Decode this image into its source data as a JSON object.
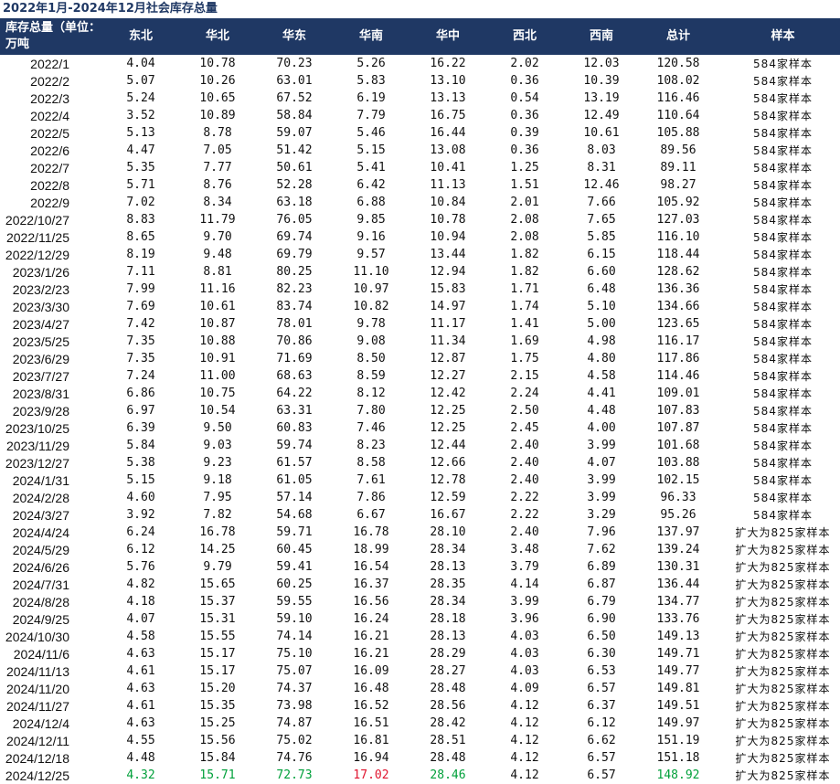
{
  "title": "2022年1月-2024年12月社会库存总量",
  "colors": {
    "header_bg": "#1f3864",
    "header_text": "#ffffff",
    "up": "#e0142e",
    "down": "#00a03a"
  },
  "headers": [
    "库存总量（单位：万吨",
    "东北",
    "华北",
    "华东",
    "华南",
    "华中",
    "西北",
    "西南",
    "总计",
    "样本"
  ],
  "rows": [
    [
      "2022/1",
      "4.04",
      "10.78",
      "70.23",
      "5.26",
      "16.22",
      "2.02",
      "12.03",
      "120.58",
      "584家样本"
    ],
    [
      "2022/2",
      "5.07",
      "10.26",
      "63.01",
      "5.83",
      "13.10",
      "0.36",
      "10.39",
      "108.02",
      "584家样本"
    ],
    [
      "2022/3",
      "5.24",
      "10.65",
      "67.52",
      "6.19",
      "13.13",
      "0.54",
      "13.19",
      "116.46",
      "584家样本"
    ],
    [
      "2022/4",
      "3.52",
      "10.89",
      "58.84",
      "7.79",
      "16.75",
      "0.36",
      "12.49",
      "110.64",
      "584家样本"
    ],
    [
      "2022/5",
      "5.13",
      "8.78",
      "59.07",
      "5.46",
      "16.44",
      "0.39",
      "10.61",
      "105.88",
      "584家样本"
    ],
    [
      "2022/6",
      "4.47",
      "7.05",
      "51.42",
      "5.15",
      "13.08",
      "0.36",
      "8.03",
      "89.56",
      "584家样本"
    ],
    [
      "2022/7",
      "5.35",
      "7.77",
      "50.61",
      "5.41",
      "10.41",
      "1.25",
      "8.31",
      "89.11",
      "584家样本"
    ],
    [
      "2022/8",
      "5.71",
      "8.76",
      "52.28",
      "6.42",
      "11.13",
      "1.51",
      "12.46",
      "98.27",
      "584家样本"
    ],
    [
      "2022/9",
      "7.02",
      "8.34",
      "63.18",
      "6.88",
      "10.84",
      "2.01",
      "7.66",
      "105.92",
      "584家样本"
    ],
    [
      "2022/10/27",
      "8.83",
      "11.79",
      "76.05",
      "9.85",
      "10.78",
      "2.08",
      "7.65",
      "127.03",
      "584家样本"
    ],
    [
      "2022/11/25",
      "8.65",
      "9.70",
      "69.74",
      "9.16",
      "10.94",
      "2.08",
      "5.85",
      "116.10",
      "584家样本"
    ],
    [
      "2022/12/29",
      "8.19",
      "9.48",
      "69.79",
      "9.57",
      "13.44",
      "1.82",
      "6.15",
      "118.44",
      "584家样本"
    ],
    [
      "2023/1/26",
      "7.11",
      "8.81",
      "80.25",
      "11.10",
      "12.94",
      "1.82",
      "6.60",
      "128.62",
      "584家样本"
    ],
    [
      "2023/2/23",
      "7.99",
      "11.16",
      "82.23",
      "10.97",
      "15.83",
      "1.71",
      "6.48",
      "136.36",
      "584家样本"
    ],
    [
      "2023/3/30",
      "7.69",
      "10.61",
      "83.74",
      "10.82",
      "14.97",
      "1.74",
      "5.10",
      "134.66",
      "584家样本"
    ],
    [
      "2023/4/27",
      "7.42",
      "10.87",
      "78.01",
      "9.78",
      "11.17",
      "1.41",
      "5.00",
      "123.65",
      "584家样本"
    ],
    [
      "2023/5/25",
      "7.35",
      "10.88",
      "70.86",
      "9.08",
      "11.34",
      "1.69",
      "4.98",
      "116.17",
      "584家样本"
    ],
    [
      "2023/6/29",
      "7.35",
      "10.91",
      "71.69",
      "8.50",
      "12.87",
      "1.75",
      "4.80",
      "117.86",
      "584家样本"
    ],
    [
      "2023/7/27",
      "7.24",
      "11.00",
      "68.63",
      "8.59",
      "12.27",
      "2.15",
      "4.58",
      "114.46",
      "584家样本"
    ],
    [
      "2023/8/31",
      "6.86",
      "10.75",
      "64.22",
      "8.12",
      "12.42",
      "2.24",
      "4.41",
      "109.01",
      "584家样本"
    ],
    [
      "2023/9/28",
      "6.97",
      "10.54",
      "63.31",
      "7.80",
      "12.25",
      "2.50",
      "4.48",
      "107.83",
      "584家样本"
    ],
    [
      "2023/10/25",
      "6.39",
      "9.50",
      "60.83",
      "7.46",
      "12.25",
      "2.45",
      "4.00",
      "107.87",
      "584家样本"
    ],
    [
      "2023/11/29",
      "5.84",
      "9.03",
      "59.74",
      "8.23",
      "12.44",
      "2.40",
      "3.99",
      "101.68",
      "584家样本"
    ],
    [
      "2023/12/27",
      "5.38",
      "9.23",
      "61.57",
      "8.58",
      "12.66",
      "2.40",
      "4.07",
      "103.88",
      "584家样本"
    ],
    [
      "2024/1/31",
      "5.15",
      "9.18",
      "61.05",
      "7.61",
      "12.78",
      "2.40",
      "3.99",
      "102.15",
      "584家样本"
    ],
    [
      "2024/2/28",
      "4.60",
      "7.95",
      "57.14",
      "7.86",
      "12.59",
      "2.22",
      "3.99",
      "96.33",
      "584家样本"
    ],
    [
      "2024/3/27",
      "3.92",
      "7.82",
      "54.68",
      "6.67",
      "16.67",
      "2.22",
      "3.29",
      "95.26",
      "584家样本"
    ],
    [
      "2024/4/24",
      "6.24",
      "16.78",
      "59.71",
      "16.78",
      "28.10",
      "2.40",
      "7.96",
      "137.97",
      "扩大为825家样本"
    ],
    [
      "2024/5/29",
      "6.12",
      "14.25",
      "60.45",
      "18.99",
      "28.34",
      "3.48",
      "7.62",
      "139.24",
      "扩大为825家样本"
    ],
    [
      "2024/6/26",
      "5.76",
      "9.79",
      "59.41",
      "16.54",
      "28.13",
      "3.79",
      "6.89",
      "130.31",
      "扩大为825家样本"
    ],
    [
      "2024/7/31",
      "4.82",
      "15.65",
      "60.25",
      "16.37",
      "28.35",
      "4.14",
      "6.87",
      "136.44",
      "扩大为825家样本"
    ],
    [
      "2024/8/28",
      "4.18",
      "15.37",
      "59.55",
      "16.56",
      "28.34",
      "3.99",
      "6.79",
      "134.77",
      "扩大为825家样本"
    ],
    [
      "2024/9/25",
      "4.07",
      "15.31",
      "59.10",
      "16.24",
      "28.18",
      "3.96",
      "6.90",
      "133.76",
      "扩大为825家样本"
    ],
    [
      "2024/10/30",
      "4.58",
      "15.55",
      "74.14",
      "16.21",
      "28.13",
      "4.03",
      "6.50",
      "149.13",
      "扩大为825家样本"
    ],
    [
      "2024/11/6",
      "4.63",
      "15.17",
      "75.10",
      "16.21",
      "28.29",
      "4.03",
      "6.30",
      "149.71",
      "扩大为825家样本"
    ],
    [
      "2024/11/13",
      "4.61",
      "15.17",
      "75.07",
      "16.09",
      "28.27",
      "4.03",
      "6.53",
      "149.77",
      "扩大为825家样本"
    ],
    [
      "2024/11/20",
      "4.63",
      "15.20",
      "74.37",
      "16.48",
      "28.48",
      "4.09",
      "6.57",
      "149.81",
      "扩大为825家样本"
    ],
    [
      "2024/11/27",
      "4.61",
      "15.35",
      "73.98",
      "16.52",
      "28.56",
      "4.12",
      "6.37",
      "149.51",
      "扩大为825家样本"
    ],
    [
      "2024/12/4",
      "4.63",
      "15.25",
      "74.87",
      "16.51",
      "28.42",
      "4.12",
      "6.12",
      "149.97",
      "扩大为825家样本"
    ],
    [
      "2024/12/11",
      "4.55",
      "15.56",
      "75.02",
      "16.81",
      "28.51",
      "4.12",
      "6.62",
      "151.19",
      "扩大为825家样本"
    ],
    [
      "2024/12/18",
      "4.48",
      "15.84",
      "74.76",
      "16.94",
      "28.48",
      "4.12",
      "6.57",
      "151.18",
      "扩大为825家样本"
    ],
    [
      "2024/12/25",
      "4.32",
      "15.71",
      "72.73",
      "17.02",
      "28.46",
      "4.12",
      "6.57",
      "148.92",
      "扩大为825家样本"
    ]
  ],
  "last_row_colors": [
    "",
    "down",
    "down",
    "down",
    "up",
    "down",
    "",
    "",
    "down",
    ""
  ]
}
